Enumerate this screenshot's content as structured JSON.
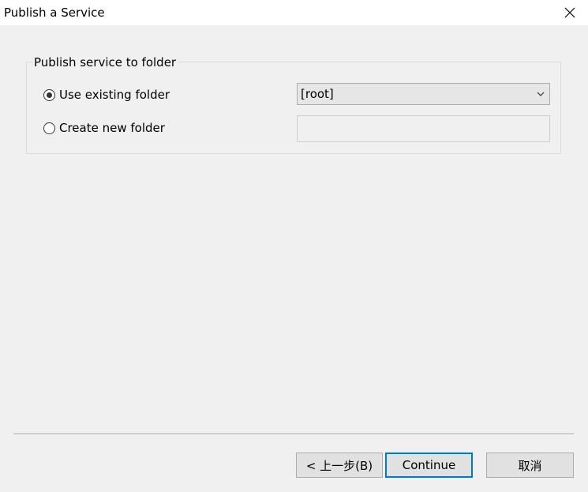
{
  "window": {
    "title": "Publish a Service"
  },
  "group": {
    "legend": "Publish service to folder"
  },
  "options": {
    "existing": {
      "label": "Use existing folder",
      "selected": true
    },
    "new": {
      "label": "Create new folder",
      "selected": false
    }
  },
  "folder_select": {
    "value": "[root]"
  },
  "new_folder_input": {
    "value": ""
  },
  "buttons": {
    "back": "< 上一步(B)",
    "continue": "Continue",
    "cancel": "取消"
  },
  "icons": {
    "close": "close-icon",
    "dropdown": "chevron-down-icon"
  }
}
